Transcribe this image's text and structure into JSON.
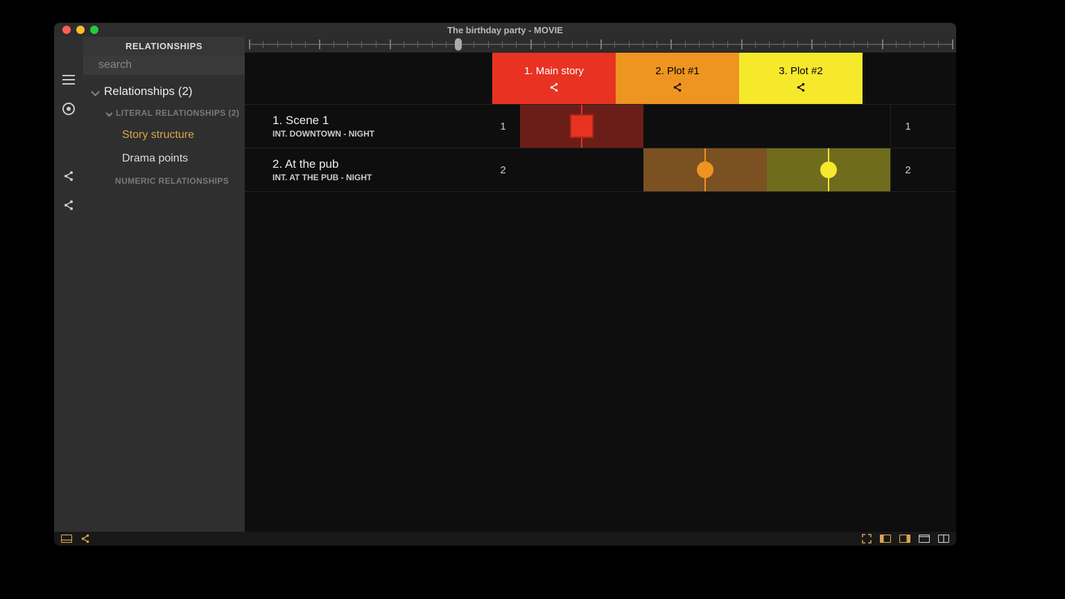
{
  "window": {
    "title": "The birthday party - MOVIE"
  },
  "sidebar": {
    "header": "RELATIONSHIPS",
    "search_placeholder": "search",
    "root": "Relationships (2)",
    "cat_literal": "LITERAL RELATIONSHIPS (2)",
    "item_story": "Story structure",
    "item_drama": "Drama points",
    "cat_numeric": "NUMERIC RELATIONSHIPS"
  },
  "plots": {
    "p1": "1. Main story",
    "p2": "2. Plot #1",
    "p3": "3. Plot #2"
  },
  "colors": {
    "p1": "#e83323",
    "p2": "#ee9421",
    "p3": "#f6e92c"
  },
  "scenes": [
    {
      "idx": "1",
      "title": "1. Scene 1",
      "loc": "INT.  DOWNTOWN - NIGHT"
    },
    {
      "idx": "2",
      "title": "2. At the pub",
      "loc": "INT.  AT THE PUB - NIGHT"
    }
  ],
  "footer": {
    "label": "Story structure"
  }
}
